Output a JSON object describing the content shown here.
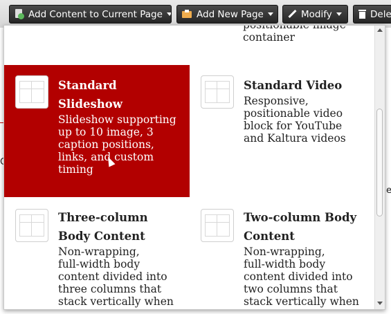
{
  "toolbar": {
    "add_content": "Add Content to Current Page",
    "add_page": "Add New Page",
    "modify": "Modify",
    "delete": "Dele"
  },
  "top_fragment": {
    "line1": "positionable image",
    "line2": "container"
  },
  "items": [
    {
      "title_line1": "Standard",
      "title_line2": "Slideshow",
      "desc": [
        "Slideshow supporting",
        "up to 10 image, 3",
        "caption positions,",
        "links, and custom",
        "timing"
      ]
    },
    {
      "title_line1": "Standard Video",
      "title_line2": "",
      "desc": [
        "Responsive,",
        "positionable video",
        "block for YouTube",
        "and Kaltura videos"
      ]
    },
    {
      "title_line1": "Three-column",
      "title_line2": "Body Content",
      "desc": [
        "Non-wrapping,",
        "full-width body",
        "content divided into",
        "three columns that",
        "stack vertically when"
      ]
    },
    {
      "title_line1": "Two-column Body",
      "title_line2": "Content",
      "desc": [
        "Non-wrapping,",
        "full-width body",
        "content divided into",
        "two columns that",
        "stack vertically when"
      ]
    }
  ],
  "background": {
    "right_e": "e",
    "left_c": "C"
  },
  "colors": {
    "selected_bg": "#b20000",
    "toolbar_btn": "#2f2f2f"
  }
}
